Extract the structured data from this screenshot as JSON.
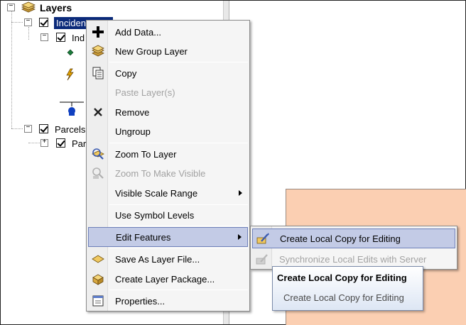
{
  "toc": {
    "root_label": "Layers",
    "group_label": "Inciden",
    "sublayer_label": "Ind",
    "parcels_group_label": "Parcels",
    "parcels_layer_label": "Par"
  },
  "context_menu": {
    "items": [
      {
        "label": "Add Data...",
        "icon": "add-data-icon",
        "enabled": true
      },
      {
        "label": "New Group Layer",
        "icon": "group-layer-icon",
        "enabled": true
      },
      {
        "label": "Copy",
        "icon": "copy-icon",
        "enabled": true
      },
      {
        "label": "Paste Layer(s)",
        "icon": "paste-icon",
        "enabled": false
      },
      {
        "label": "Remove",
        "icon": "remove-icon",
        "enabled": true
      },
      {
        "label": "Ungroup",
        "icon": "",
        "enabled": true
      },
      {
        "label": "Zoom To Layer",
        "icon": "zoom-to-layer-icon",
        "enabled": true
      },
      {
        "label": "Zoom To Make Visible",
        "icon": "zoom-to-visible-icon",
        "enabled": false
      },
      {
        "label": "Visible Scale Range",
        "icon": "",
        "enabled": true,
        "submenu": true
      },
      {
        "label": "Use Symbol Levels",
        "icon": "",
        "enabled": true
      },
      {
        "label": "Edit Features",
        "icon": "",
        "enabled": true,
        "submenu": true,
        "highlighted": true
      },
      {
        "label": "Save As Layer File...",
        "icon": "layer-file-icon",
        "enabled": true
      },
      {
        "label": "Create Layer Package...",
        "icon": "layer-package-icon",
        "enabled": true
      },
      {
        "label": "Properties...",
        "icon": "properties-icon",
        "enabled": true
      }
    ]
  },
  "submenu": {
    "items": [
      {
        "label": "Create Local Copy for Editing",
        "icon": "create-local-copy-icon",
        "enabled": true,
        "highlighted": true
      },
      {
        "label": "Synchronize Local Edits with Server",
        "icon": "synchronize-icon",
        "enabled": false
      }
    ]
  },
  "tooltip": {
    "title": "Create Local Copy for Editing",
    "body": "Create Local Copy for Editing"
  },
  "colors": {
    "selection": "#0b2a7a",
    "menu_highlight": "#c3cbe6",
    "parcel_fill": "#fbcfb2"
  }
}
